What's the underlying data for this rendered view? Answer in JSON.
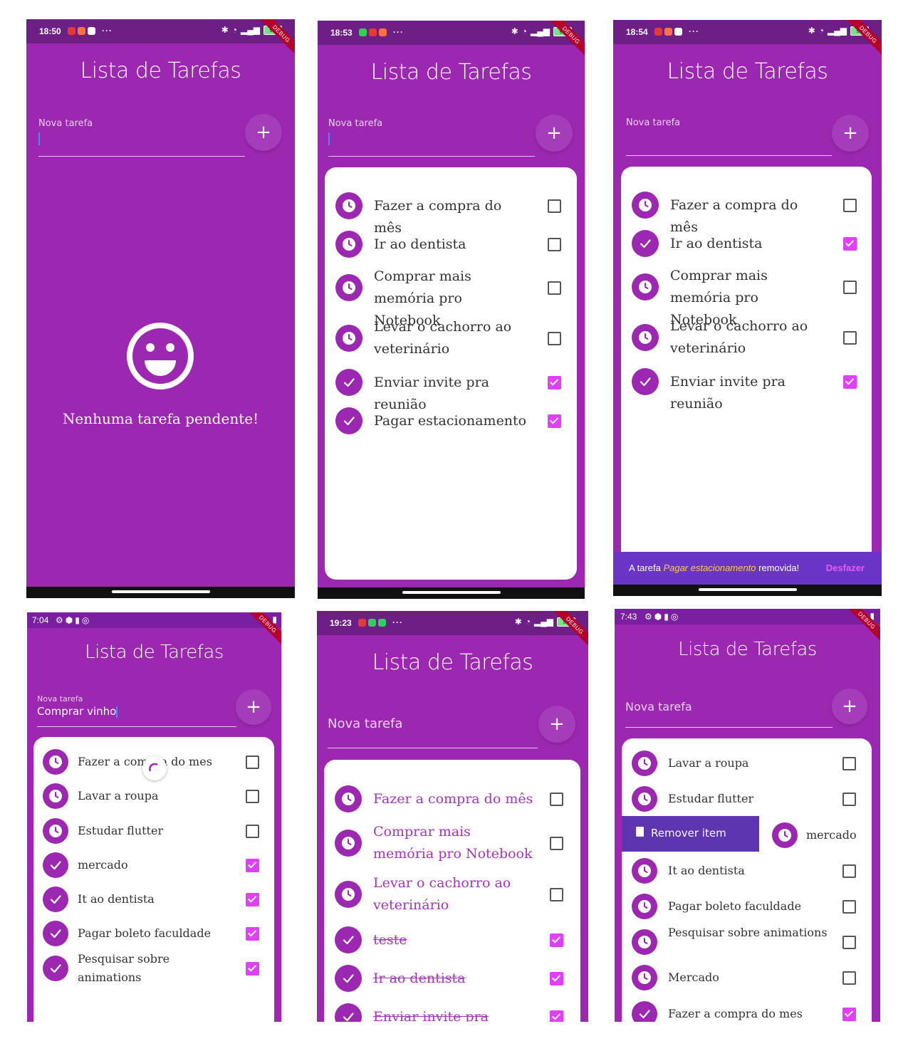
{
  "colors": {
    "primary": "#9c27b0",
    "status_bar": "#6e1f86",
    "check_on": "#e040fb",
    "snackbar": "#6a34c7",
    "snack_action": "#e35df5",
    "remove_bg": "#5e35b1",
    "debug_banner": "#b5002b"
  },
  "icons": {
    "pending": "clock-icon",
    "done": "check-icon",
    "add": "plus-icon",
    "empty": "smiley-icon",
    "delete": "trash-icon"
  },
  "debug_label": "DEBUG",
  "screens": [
    {
      "status_time": "18:50",
      "status_dots": "···",
      "battery": "96",
      "title": "Lista de Tarefas",
      "input_label": "Nova tarefa",
      "add_label": "+",
      "empty_message": "Nenhuma tarefa pendente!"
    },
    {
      "status_time": "18:53",
      "status_dots": "···",
      "battery": "95",
      "title": "Lista de Tarefas",
      "input_label": "Nova tarefa",
      "add_label": "+",
      "tasks": [
        {
          "text": "Fazer a compra do mês",
          "done": false
        },
        {
          "text": "Ir ao dentista",
          "done": false
        },
        {
          "text": "Comprar mais memória pro Notebook",
          "done": false
        },
        {
          "text": "Levar o cachorro ao veterinário",
          "done": false
        },
        {
          "text": "Enviar invite pra reunião",
          "done": true
        },
        {
          "text": "Pagar estacionamento",
          "done": true
        }
      ]
    },
    {
      "status_time": "18:54",
      "status_dots": "···",
      "battery": "95",
      "title": "Lista de Tarefas",
      "input_label": "Nova tarefa",
      "add_label": "+",
      "tasks": [
        {
          "text": "Fazer a compra do mês",
          "done": false
        },
        {
          "text": "Ir ao dentista",
          "done": true
        },
        {
          "text": "Comprar mais memória pro Notebook",
          "done": false
        },
        {
          "text": "Levar o cachorro ao veterinário",
          "done": false
        },
        {
          "text": "Enviar invite pra reunião",
          "done": true
        }
      ],
      "snackbar": {
        "prefix": "A tarefa",
        "task": "Pagar estacionamento",
        "suffix": "removida!",
        "action": "Desfazer"
      }
    },
    {
      "status_time": "7:04",
      "title": "Lista de Tarefas",
      "input_label": "Nova tarefa",
      "input_value": "Comprar vinho",
      "add_label": "+",
      "tasks": [
        {
          "text": "Fazer a compra do mes",
          "done": false
        },
        {
          "text": "Lavar a roupa",
          "done": false
        },
        {
          "text": "Estudar flutter",
          "done": false
        },
        {
          "text": "mercado",
          "done": true
        },
        {
          "text": "It ao dentista",
          "done": true
        },
        {
          "text": "Pagar boleto faculdade",
          "done": true
        },
        {
          "text": "Pesquisar sobre animations",
          "done": true
        }
      ]
    },
    {
      "status_time": "19:23",
      "status_dots": "···",
      "battery": "97",
      "title": "Lista de Tarefas",
      "input_label": "Nova tarefa",
      "add_label": "+",
      "tasks": [
        {
          "text": "Fazer a compra do mês",
          "done": false
        },
        {
          "text": "Comprar mais memória pro Notebook",
          "done": false
        },
        {
          "text": "Levar o cachorro ao veterinário",
          "done": false
        },
        {
          "text": "teste",
          "done": true
        },
        {
          "text": "Ir ao dentista",
          "done": true
        },
        {
          "text": "Enviar invite pra reunião",
          "done": true
        }
      ]
    },
    {
      "status_time": "7:43",
      "title": "Lista de Tarefas",
      "input_label": "Nova tarefa",
      "add_label": "+",
      "remove_label": "Remover item",
      "tasks": [
        {
          "text": "Lavar a roupa",
          "done": false
        },
        {
          "text": "Estudar flutter",
          "done": false
        },
        {
          "text": "mercado",
          "done": false
        },
        {
          "text": "It ao dentista",
          "done": false
        },
        {
          "text": "Pagar boleto faculdade",
          "done": false
        },
        {
          "text": "Pesquisar sobre animations",
          "done": false
        },
        {
          "text": "Mercado",
          "done": false
        },
        {
          "text": "Fazer a compra do mes",
          "done": true
        }
      ]
    }
  ]
}
